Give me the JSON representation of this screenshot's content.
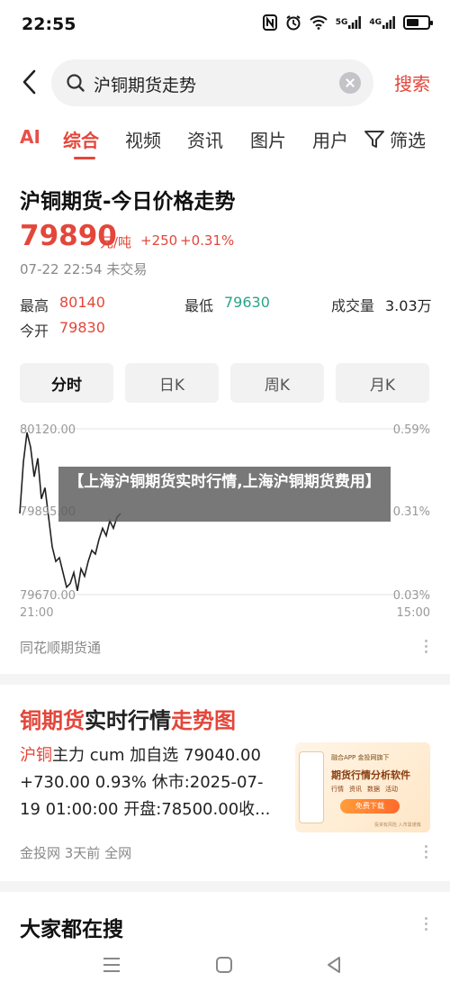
{
  "status": {
    "time": "22:55",
    "signal1": "5G",
    "signal2": "4G"
  },
  "search": {
    "query": "沪铜期货走势",
    "submit_label": "搜索"
  },
  "tabs": {
    "ai": "AI",
    "items": [
      "综合",
      "视频",
      "资讯",
      "图片",
      "用户"
    ],
    "filter": "筛选"
  },
  "quote": {
    "title": "沪铜期货-今日价格走势",
    "price": "79890",
    "unit": "元/吨",
    "change_abs": "+250",
    "change_pct": "+0.31%",
    "timestamp": "07-22 22:54 未交易",
    "high_label": "最高",
    "high": "80140",
    "low_label": "最低",
    "low": "79630",
    "volume_label": "成交量",
    "volume": "3.03万",
    "open_label": "今开",
    "open": "79830",
    "periods": [
      "分时",
      "日K",
      "周K",
      "月K"
    ],
    "source": "同花顺期货通"
  },
  "chart_data": {
    "type": "line",
    "y_left_ticks": [
      "80120.00",
      "79895.00",
      "79670.00"
    ],
    "y_right_ticks": [
      "0.59%",
      "0.31%",
      "0.03%"
    ],
    "x_ticks": [
      "21:00",
      "15:00"
    ],
    "ylim": [
      79670,
      80120
    ],
    "series": [
      {
        "values": [
          79890,
          80030,
          80110,
          80070,
          79990,
          80040,
          79930,
          79960,
          79880,
          79800,
          79760,
          79770,
          79730,
          79690,
          79700,
          79730,
          79680,
          79740,
          79720,
          79760,
          79790,
          79780,
          79820,
          79850,
          79830,
          79870,
          79850,
          79880,
          79890
        ]
      }
    ],
    "colors": {
      "line": "#222222",
      "grid": "#e5e5e5"
    }
  },
  "overlay": {
    "title": "【上海沪铜期货实时行情,上海沪铜期货费用】"
  },
  "article": {
    "title_a": "铜期货",
    "title_b": "实时行情",
    "title_c": "走势图",
    "body_hl": "沪铜",
    "body": "主力 cum 加自选 79040.00 +730.00 0.93% 休市:2025-07-19 01:00:00 开盘:78500.00收...",
    "meta": "金投网   3天前   全网",
    "ad": {
      "app_line": "融合APP 金投网旗下",
      "headline": "期货行情分析软件",
      "features": [
        "行情",
        "资讯",
        "数据",
        "活动"
      ],
      "download": "免费下载",
      "note": "投资有风险 入市需谨慎"
    }
  },
  "related": {
    "title": "大家都在搜"
  },
  "colors": {
    "accent": "#e3463a",
    "green": "#2aa388"
  }
}
